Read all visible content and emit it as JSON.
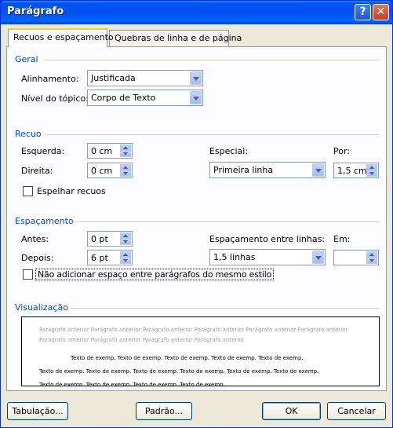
{
  "window": {
    "title": "Parágrafo",
    "help_glyph": "?",
    "close_glyph": "✕"
  },
  "tabs": [
    "Recuos e espaçamento",
    "Quebras de linha e de página"
  ],
  "geral": {
    "label": "Geral",
    "alinhamento_label": "Alinhamento:",
    "alinhamento_value": "Justificada",
    "nivel_label": "Nível do tópico:",
    "nivel_value": "Corpo de Texto"
  },
  "recuo": {
    "label": "Recuo",
    "esquerda_label": "Esquerda:",
    "esquerda_value": "0 cm",
    "direita_label": "Direita:",
    "direita_value": "0 cm",
    "especial_label": "Especial:",
    "especial_value": "Primeira linha",
    "por_label": "Por:",
    "por_value": "1,5 cm",
    "espelhar_label": "Espelhar recuos"
  },
  "espacamento": {
    "label": "Espaçamento",
    "antes_label": "Antes:",
    "antes_value": "0 pt",
    "depois_label": "Depois:",
    "depois_value": "6 pt",
    "entre_linhas_label": "Espaçamento entre linhas:",
    "entre_linhas_value": "1,5 linhas",
    "em_label": "Em:",
    "em_value": "",
    "nao_adicionar_label": "Não adicionar espaço entre parágrafos do mesmo estilo"
  },
  "visualizacao": {
    "label": "Visualização",
    "prev_text": "Parágrafo anterior Parágrafo anterior Parágrafo anterior Parágrafo anterior Parágrafo anterior Parágrafo anterior Parágrafo anterior Parágrafo anterior Parágrafo anterior Parágrafo anterior",
    "line1": "Texto de exemp. Texto de exemp. Texto de exemp. Texto de exemp. Texto de exemp.",
    "line2": "Texto de exemp. Texto de exemp. Texto de exemp. Texto de exemp. Texto de exemp. Texto de exemp.",
    "line3": "Texto de exemp. Texto de exemp. Texto de exemp. Texto de exemp."
  },
  "buttons": {
    "tabulacao": "Tabulação...",
    "padrao": "Padrão...",
    "ok": "OK",
    "cancelar": "Cancelar"
  }
}
